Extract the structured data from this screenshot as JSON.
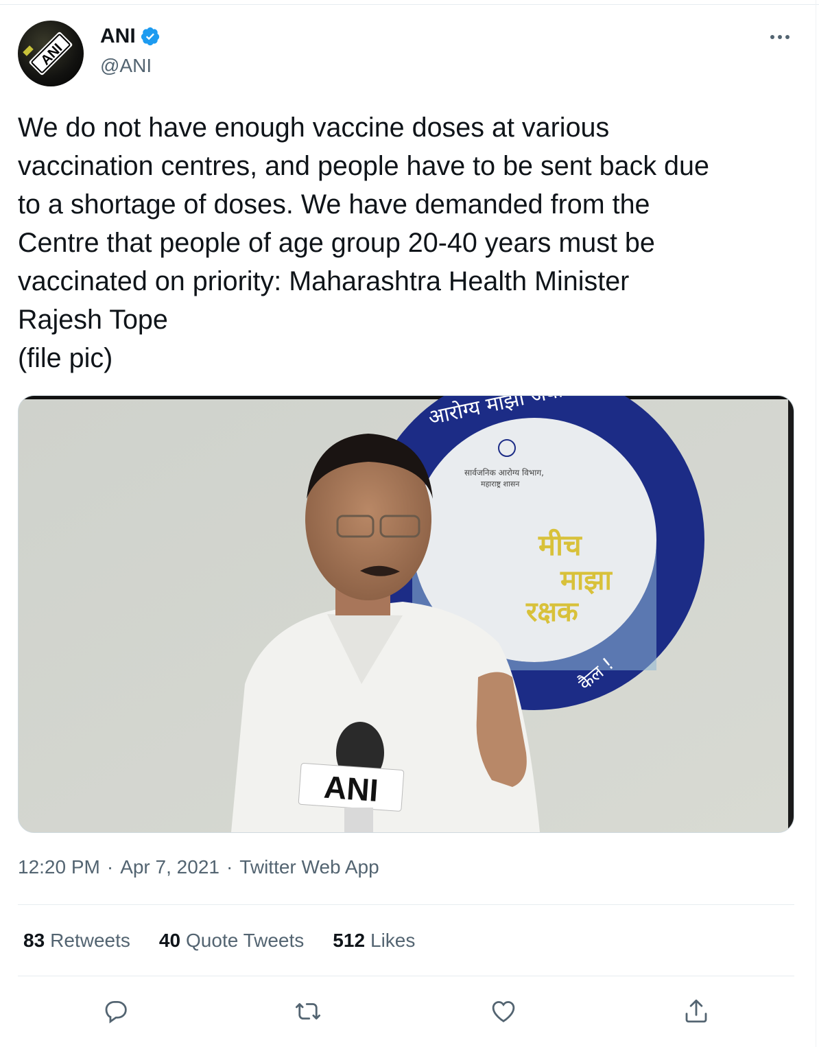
{
  "author": {
    "display_name": "ANI",
    "handle": "@ANI",
    "verified": true,
    "avatar_text": "ANI",
    "avatar_icon": "ani-logo-icon"
  },
  "tweet": {
    "text": "We do not have enough vaccine doses at various\nvaccination centres, and people have to be sent back due\nto a shortage of doses. We have demanded from the\nCentre that people of age group 20-40 years must be\nvaccinated on priority: Maharashtra Health Minister\nRajesh Tope\n(file pic)"
  },
  "media": {
    "mic_label": "ANI",
    "banner_top": "आरोग्य माझी जबाबदारी",
    "banner_dept": "सार्वजनिक आरोग्य विभाग,",
    "banner_state": "महाराष्ट्र शासन",
    "banner_line1": "मीच",
    "banner_line2": "माझा",
    "banner_line3": "रक्षक",
    "banner_side": "कैल !"
  },
  "meta": {
    "time": "12:20 PM",
    "date": "Apr 7, 2021",
    "source": "Twitter Web App",
    "separator": "·"
  },
  "stats": {
    "retweets_count": "83",
    "retweets_label": "Retweets",
    "quotes_count": "40",
    "quotes_label": "Quote Tweets",
    "likes_count": "512",
    "likes_label": "Likes"
  },
  "actions": [
    "reply-icon",
    "retweet-icon",
    "like-icon",
    "share-icon"
  ],
  "colors": {
    "verified": "#1d9bf0",
    "secondary_text": "#536471",
    "primary_text": "#0f1419",
    "banner_blue": "#1d2e8a",
    "banner_gold": "#d8c13a"
  }
}
